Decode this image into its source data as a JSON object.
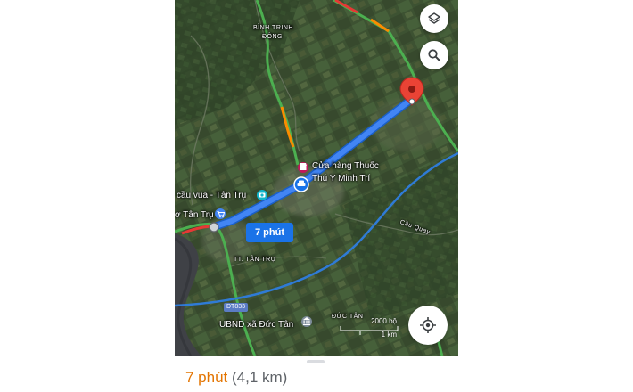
{
  "map": {
    "place_labels": {
      "binh_trinh_line1": "BÌNH TRINH",
      "binh_trinh_line2": "ĐÔNG",
      "store_line1": "Cửa hàng Thuốc",
      "store_line2": "Thú Y Minh Trí",
      "cau_vua": "cầu vua - Tân Trụ",
      "cho_tan_tru": "ợ Tân Trụ",
      "cau_quay": "Cầu Quay",
      "tt_tan_tru": "TT. TÂN TRỤ",
      "duc_tan": "ĐỨC TÂN",
      "ubnd": "UBND xã Đức Tân",
      "road_dt833": "DT833"
    },
    "route_eta_badge": "7 phút",
    "scale": {
      "imperial": "2000 bộ",
      "metric": "1 km"
    },
    "colors": {
      "route": "#4285f4",
      "route_badge": "#1a73e8",
      "destination_pin": "#ea4335",
      "traffic_green": "#4caf50",
      "traffic_orange": "#fb8c00",
      "traffic_red": "#e53935",
      "water": "#3f4146",
      "highway": "#2f7bd6"
    },
    "icons": [
      "layers-icon",
      "search-icon",
      "destination-pin-icon",
      "store-icon",
      "car-icon",
      "camera-icon",
      "shopping-cart-icon",
      "government-building-icon",
      "my-location-icon"
    ]
  },
  "route_summary": {
    "duration": "7 phút",
    "distance": "(4,1 km)"
  }
}
